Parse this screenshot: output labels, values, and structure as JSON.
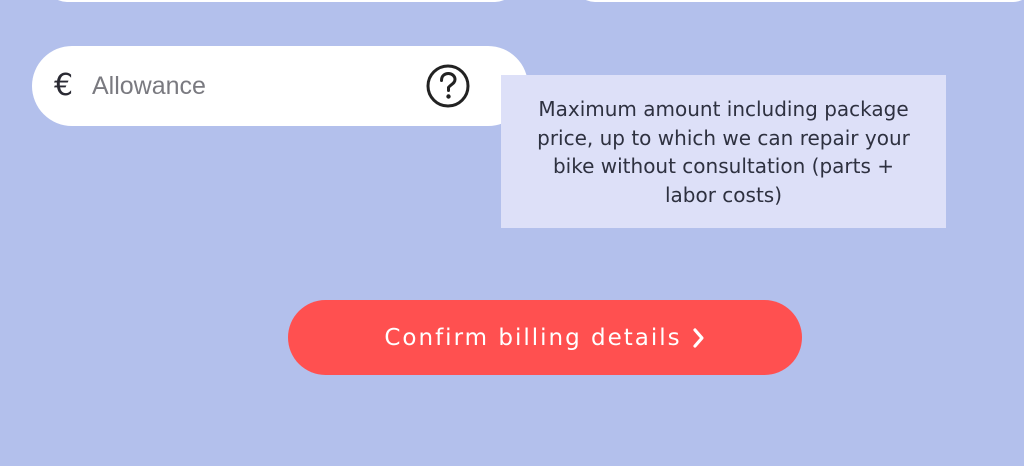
{
  "allowance": {
    "currency_symbol": "€",
    "placeholder": "Allowance",
    "value": ""
  },
  "help": {
    "icon": "question-circle-icon"
  },
  "tooltip": {
    "text": "Maximum amount including package price, up to which we can repair your bike without consultation (parts + labor costs)"
  },
  "confirm": {
    "label": "Confirm billing details",
    "icon": "chevron-right-icon"
  },
  "colors": {
    "background": "#b3c0ec",
    "button": "#ff5050",
    "tooltip_bg": "#dde0f8"
  }
}
